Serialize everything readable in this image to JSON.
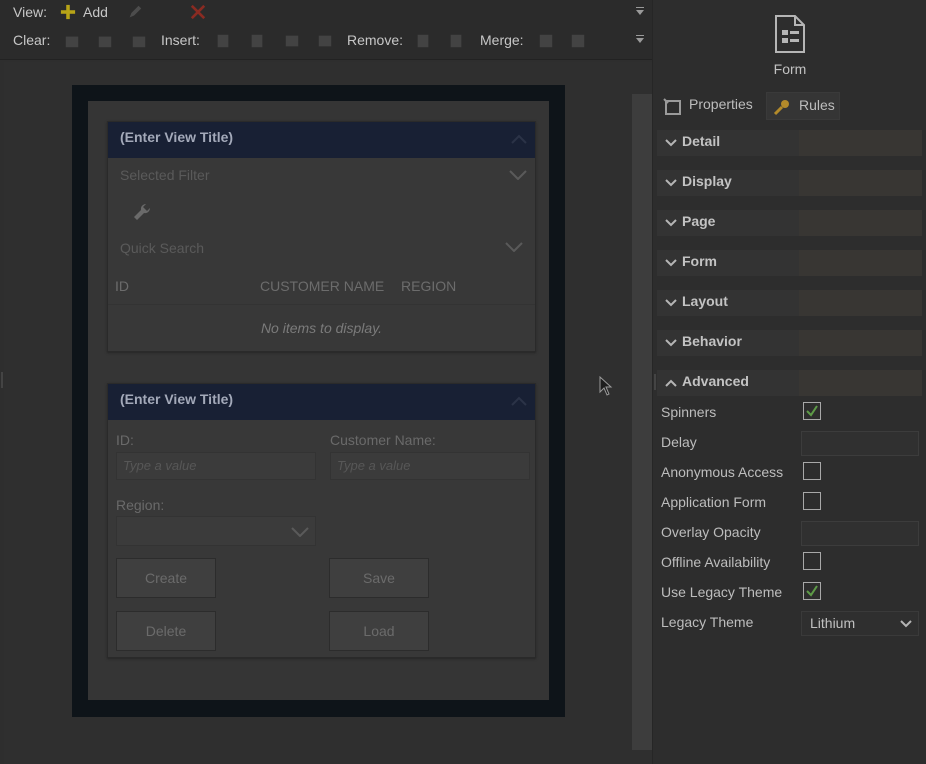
{
  "toolbar": {
    "view_label": "View:",
    "add_label": "Add",
    "clear_label": "Clear:",
    "insert_label": "Insert:",
    "remove_label": "Remove:",
    "merge_label": "Merge:"
  },
  "view1": {
    "title": "(Enter View Title)",
    "selected_filter_placeholder": "Selected Filter",
    "quick_search_placeholder": "Quick Search",
    "columns": [
      "ID",
      "CUSTOMER NAME",
      "REGION"
    ],
    "empty_text": "No items to display."
  },
  "view2": {
    "title": "(Enter View Title)",
    "id_label": "ID:",
    "id_placeholder": "Type a value",
    "customer_name_label": "Customer Name:",
    "customer_name_placeholder": "Type a value",
    "region_label": "Region:",
    "buttons": {
      "create": "Create",
      "save": "Save",
      "delete": "Delete",
      "load": "Load"
    }
  },
  "right_panel": {
    "form_label": "Form",
    "tabs": {
      "properties": "Properties",
      "rules": "Rules"
    },
    "sections": [
      "Detail",
      "Display",
      "Page",
      "Form",
      "Layout",
      "Behavior",
      "Advanced"
    ],
    "properties": {
      "spinners": {
        "label": "Spinners",
        "checked": true
      },
      "delay": {
        "label": "Delay",
        "value": ""
      },
      "anonymous_access": {
        "label": "Anonymous Access",
        "checked": false
      },
      "application_form": {
        "label": "Application Form",
        "checked": false
      },
      "overlay_opacity": {
        "label": "Overlay Opacity",
        "value": ""
      },
      "offline_availability": {
        "label": "Offline Availability",
        "checked": false
      },
      "use_legacy_theme": {
        "label": "Use Legacy Theme",
        "checked": true
      },
      "legacy_theme": {
        "label": "Legacy Theme",
        "value": "Lithium"
      }
    }
  },
  "colors": {
    "accent_add": "#b8a417",
    "accent_remove": "#8a2b22",
    "checkbox_check": "#5e9b47",
    "view_header": "#182034"
  }
}
